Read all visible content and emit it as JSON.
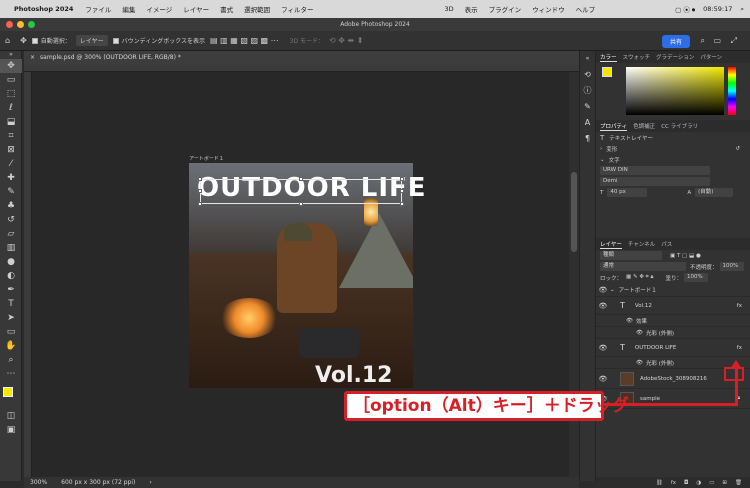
{
  "menubar": {
    "app": "Photoshop 2024",
    "items": [
      "ファイル",
      "編集",
      "イメージ",
      "レイヤー",
      "書式",
      "選択範囲",
      "フィルター",
      "3D",
      "表示",
      "プラグイン",
      "ウィンドウ",
      "ヘルプ"
    ],
    "time": "08:59:17"
  },
  "window_title": "Adobe Photoshop 2024",
  "options": {
    "auto_select": "自動選択：",
    "layer_dropdown": "レイヤー",
    "bounding_box": "バウンディングボックスを表示",
    "mode_3d": "3D モード：",
    "share": "共有"
  },
  "document": {
    "tab": "sample.psd @ 300% (OUTDOOR LIFE, RGB/8) *",
    "artboard_label": "アートボード１",
    "headline": "OUTDOOR LIFE",
    "vol_text": "Vol.12",
    "zoom": "300%",
    "size_info": "600 px x 300 px (72 ppi)"
  },
  "color_panel": {
    "tabs": [
      "カラー",
      "スウォッチ",
      "グラデーション",
      "パターン"
    ],
    "accent_foreground": "#f2e800"
  },
  "properties_panel": {
    "tabs": [
      "プロパティ",
      "色調補正",
      "CC ライブラリ"
    ],
    "kind": "テキストレイヤー",
    "transform": "変形",
    "character": "文字",
    "font_family": "URW DIN",
    "font_style": "Demi",
    "font_size": "40 px",
    "leading": "(自動)"
  },
  "layers_panel": {
    "tabs": [
      "レイヤー",
      "チャンネル",
      "パス"
    ],
    "filter": "種類",
    "blend_mode": "通常",
    "opacity_label": "不透明度：",
    "opacity_value": "100%",
    "lock_label": "ロック：",
    "fill_label": "塗り：",
    "fill_value": "100%",
    "layers": [
      {
        "name": "アートボード１",
        "type": "group"
      },
      {
        "name": "Vol.12",
        "type": "text",
        "fx": "fx"
      },
      {
        "name": "効果",
        "type": "effect-group"
      },
      {
        "name": "光彩 (外側)",
        "type": "effect"
      },
      {
        "name": "OUTDOOR LIFE",
        "type": "text",
        "fx": "fx"
      },
      {
        "name": "光彩 (外側)",
        "type": "effect"
      },
      {
        "name": "AdobeStock_308908216",
        "type": "image"
      },
      {
        "name": "sample",
        "type": "image"
      }
    ]
  },
  "callout": {
    "text": "［option（Alt）キー］＋ドラッグ",
    "color": "#d81f26"
  }
}
